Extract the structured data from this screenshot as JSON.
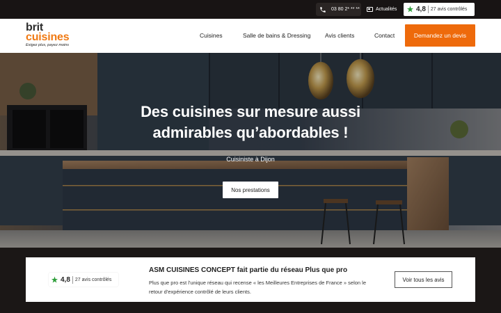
{
  "topbar": {
    "phone": "03 80 2* ** **",
    "news_label": "Actualités",
    "rating_score": "4,8",
    "rating_count": "27 avis contrôlés"
  },
  "header": {
    "logo_word1": "brit",
    "logo_word2": "cuisines",
    "logo_tagline": "Exigez plus, payez moins",
    "nav": [
      "Cuisines",
      "Salle de bains & Dressing",
      "Avis clients",
      "Contact"
    ],
    "cta_label": "Demandez un devis"
  },
  "hero": {
    "title_line1": "Des cuisines sur mesure aussi",
    "title_line2": "admirables qu’abordables !",
    "subtitle": "Cuisiniste à Dijon",
    "button_label": "Nos prestations"
  },
  "panel": {
    "rating_score": "4,8",
    "rating_count": "27 avis contrôlés",
    "title": "ASM CUISINES CONCEPT fait partie du réseau Plus que pro",
    "text": "Plus que pro est l'unique réseau qui recense « les Meilleures Entreprises de France » selon le retour d'expérience contrôlé de leurs clients.",
    "button_label": "Voir tous les avis"
  },
  "colors": {
    "accent": "#ee6a0b",
    "logo_orange": "#f07a14",
    "rating_green": "#2e9e3a",
    "dark_bar": "#181414"
  },
  "icons": [
    "phone-icon",
    "newspaper-icon",
    "star-rating-icon"
  ]
}
